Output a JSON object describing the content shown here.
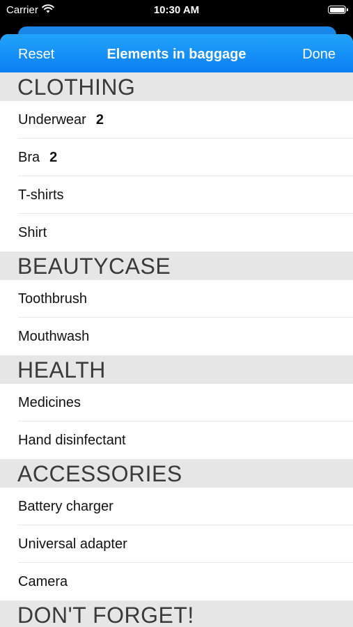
{
  "status": {
    "carrier": "Carrier",
    "time": "10:30 AM"
  },
  "nav": {
    "reset": "Reset",
    "title": "Elements in baggage",
    "done": "Done"
  },
  "sections": [
    {
      "title": "CLOTHING",
      "items": [
        {
          "name": "Underwear",
          "count": "2"
        },
        {
          "name": "Bra",
          "count": "2"
        },
        {
          "name": "T-shirts"
        },
        {
          "name": "Shirt"
        }
      ]
    },
    {
      "title": "BEAUTYCASE",
      "items": [
        {
          "name": "Toothbrush"
        },
        {
          "name": "Mouthwash"
        }
      ]
    },
    {
      "title": "HEALTH",
      "items": [
        {
          "name": "Medicines"
        },
        {
          "name": "Hand disinfectant"
        }
      ]
    },
    {
      "title": "ACCESSORIES",
      "items": [
        {
          "name": "Battery charger"
        },
        {
          "name": "Universal adapter"
        },
        {
          "name": "Camera"
        }
      ]
    },
    {
      "title": "DON'T FORGET!",
      "items": []
    }
  ],
  "colors": {
    "accent": "#0a7ff5",
    "section_bg": "#e6e6e6"
  },
  "icons": {
    "wifi": "wifi-icon",
    "battery": "battery-icon"
  }
}
